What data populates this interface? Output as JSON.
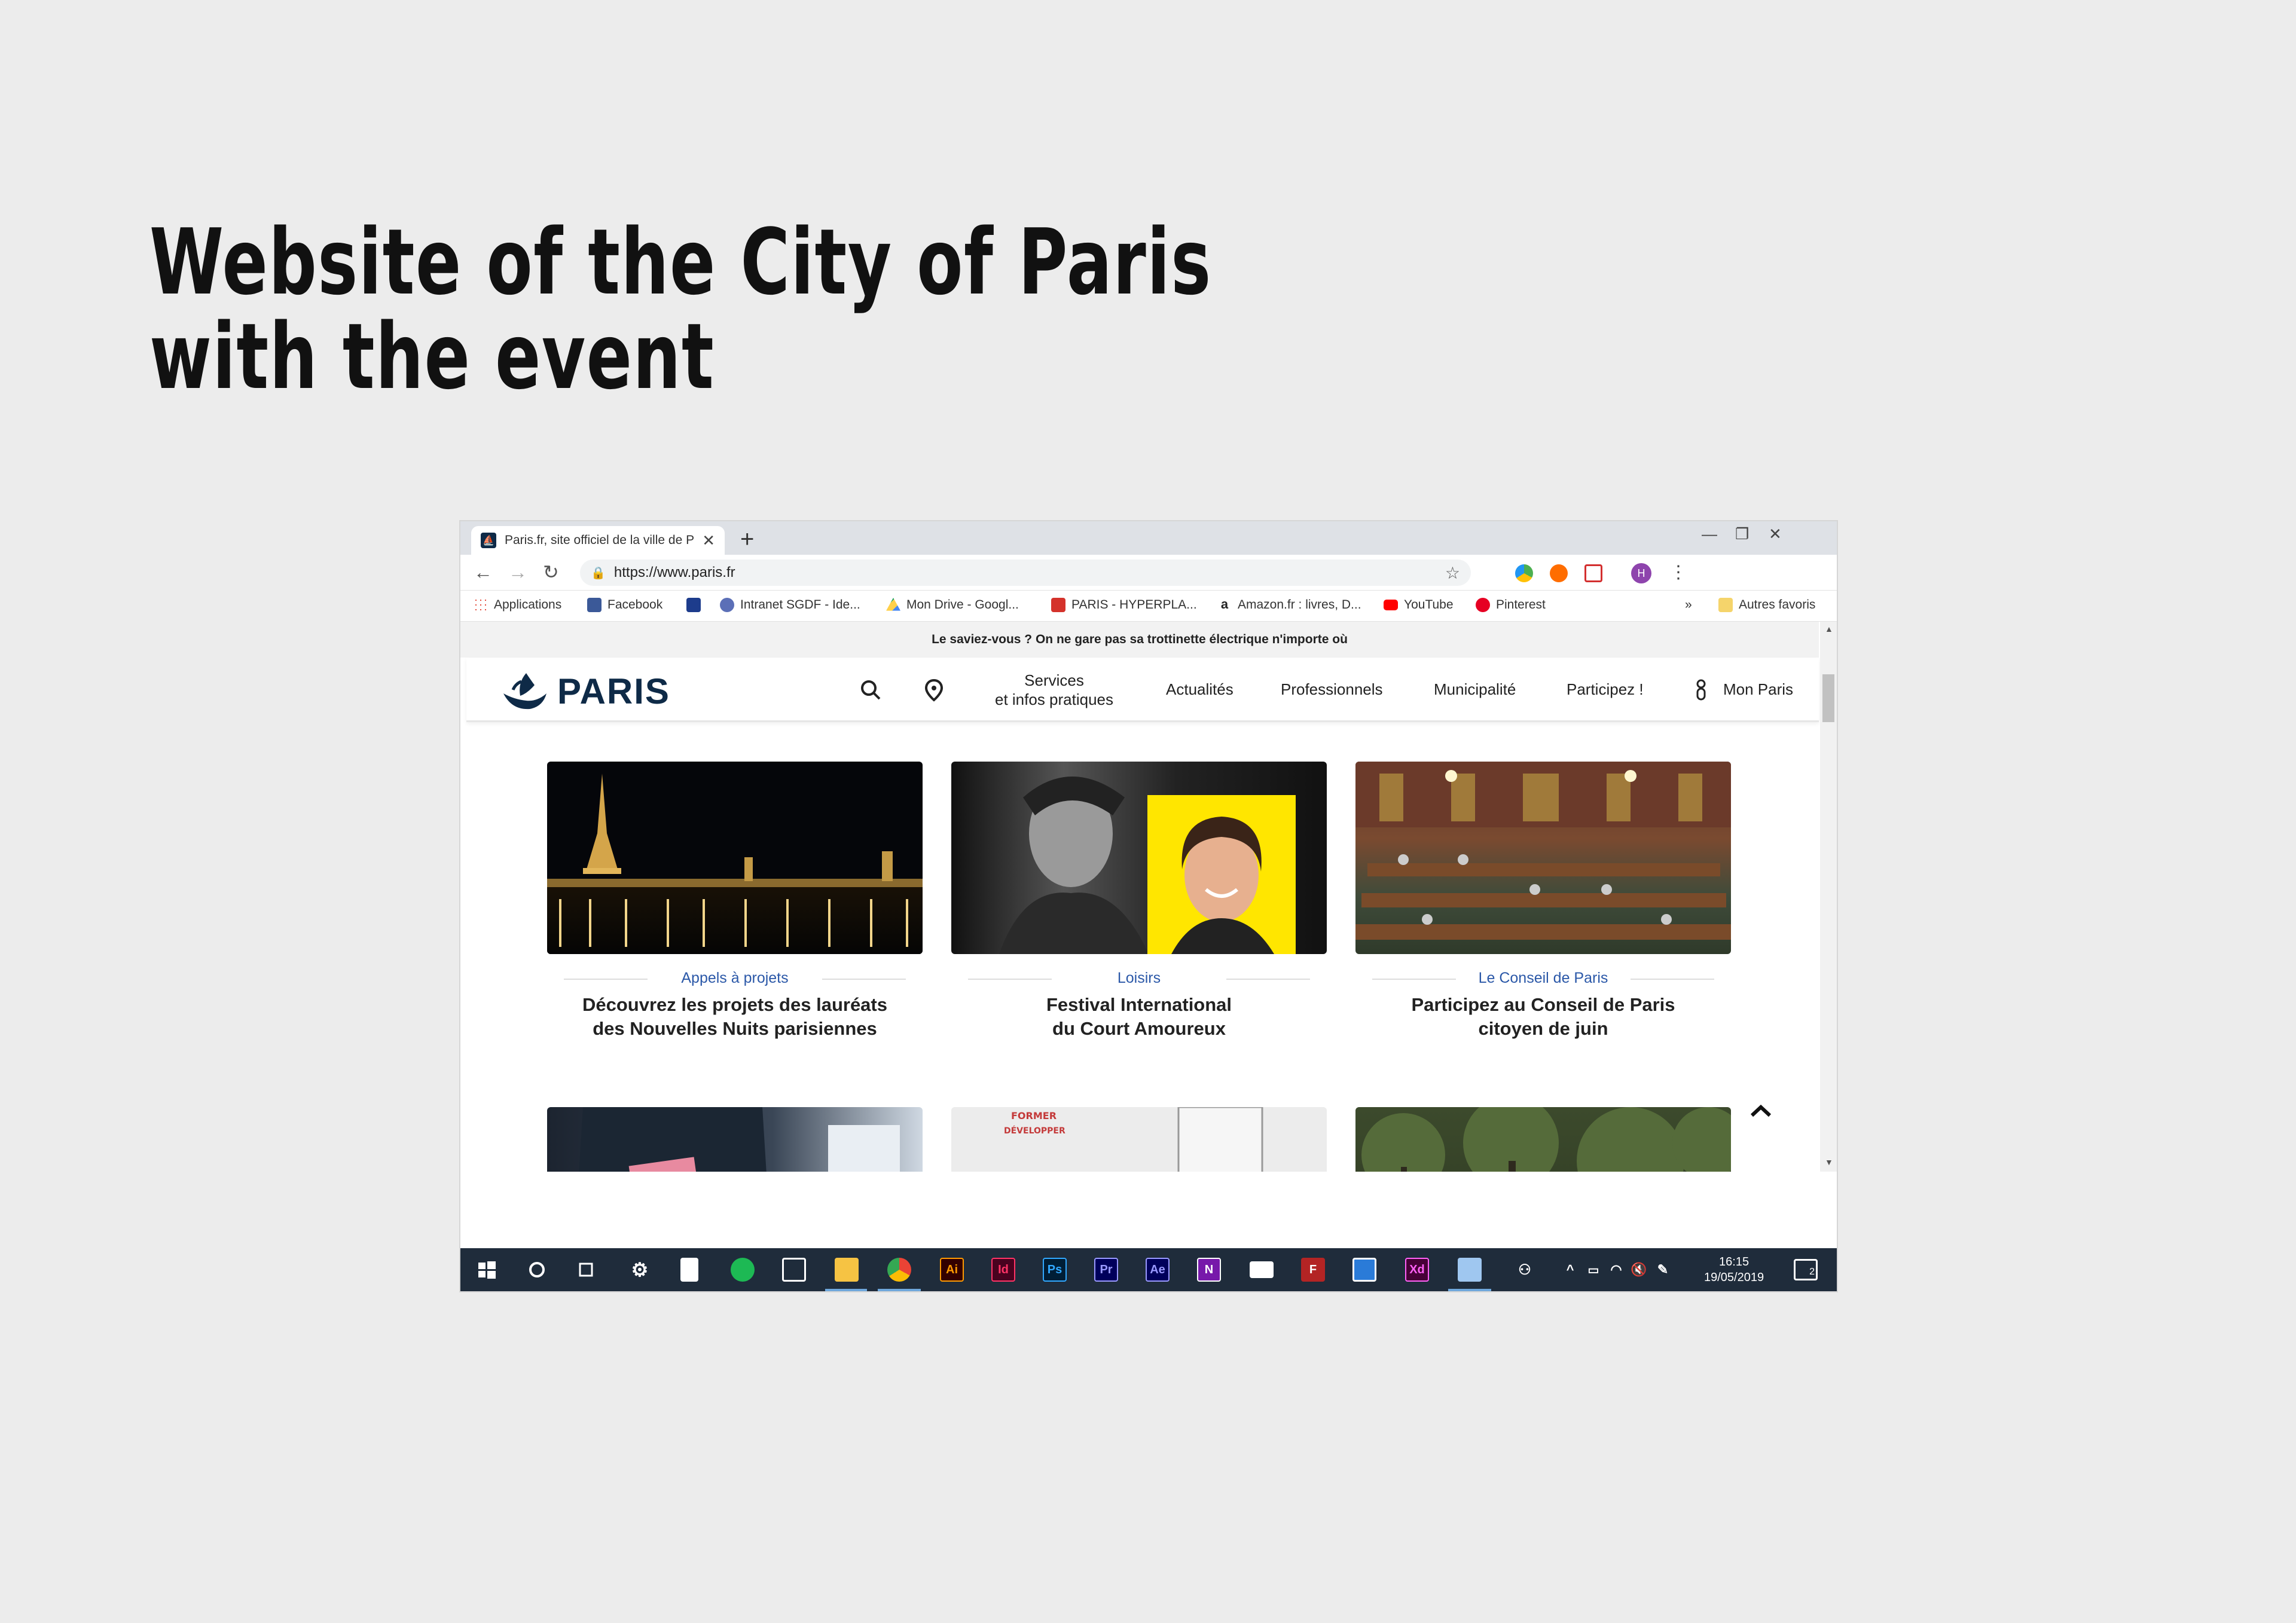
{
  "headline": {
    "line1": "Website of the City of Paris",
    "line2": "with the event"
  },
  "browser": {
    "tab_title": "Paris.fr, site officiel de la ville de Paris",
    "url": "https://www.paris.fr",
    "profile_initial": "H",
    "bookmarks": [
      {
        "label": "Applications",
        "color": "#e34b3b"
      },
      {
        "label": "Facebook",
        "color": "#3b5998"
      },
      {
        "label": "",
        "color": "#1d3c8c"
      },
      {
        "label": "Intranet SGDF - Ide...",
        "color": "#5b6fb7"
      },
      {
        "label": "Mon Drive - Googl...",
        "color": "#1fa463"
      },
      {
        "label": "PARIS - HYPERPLA...",
        "color": "#d4322b"
      },
      {
        "label": "Amazon.fr : livres, D...",
        "color": "#222222"
      },
      {
        "label": "YouTube",
        "color": "#ff0000"
      },
      {
        "label": "Pinterest",
        "color": "#e60023"
      }
    ],
    "bookmarks_more": "»",
    "other_bookmarks": "Autres favoris"
  },
  "site": {
    "banner": "Le saviez-vous ? On ne gare pas sa trottinette électrique n'importe où",
    "logo": "PARIS",
    "nav": {
      "services_line1": "Services",
      "services_line2": "et infos pratiques",
      "actualites": "Actualités",
      "professionnels": "Professionnels",
      "municipalite": "Municipalité",
      "participez": "Participez !",
      "mon_paris": "Mon Paris"
    },
    "cards": [
      {
        "category": "Appels à projets",
        "title_line1": "Découvrez les projets des lauréats",
        "title_line2": "des Nouvelles Nuits parisiennes"
      },
      {
        "category": "Loisirs",
        "title_line1": "Festival International",
        "title_line2": "du Court Amoureux"
      },
      {
        "category": "Le Conseil de Paris",
        "title_line1": "Participez au Conseil de Paris",
        "title_line2": "citoyen de juin"
      }
    ],
    "sign_text_line1": "FORMER",
    "sign_text_line2": "DÉVELOPPER"
  },
  "taskbar": {
    "apps": [
      {
        "label": "Ai",
        "color": "#ff9a00",
        "bg": "#330000"
      },
      {
        "label": "Id",
        "color": "#ff3366",
        "bg": "#49021f"
      },
      {
        "label": "Ps",
        "color": "#31a8ff",
        "bg": "#001e36"
      },
      {
        "label": "Pr",
        "color": "#9999ff",
        "bg": "#00005b"
      },
      {
        "label": "Ae",
        "color": "#9999ff",
        "bg": "#00005b"
      },
      {
        "label": "N",
        "color": "#ffffff",
        "bg": "#7719aa"
      },
      {
        "label": "Xd",
        "color": "#ff61f6",
        "bg": "#470137"
      }
    ],
    "time": "16:15",
    "date": "19/05/2019",
    "notifications": "2"
  }
}
